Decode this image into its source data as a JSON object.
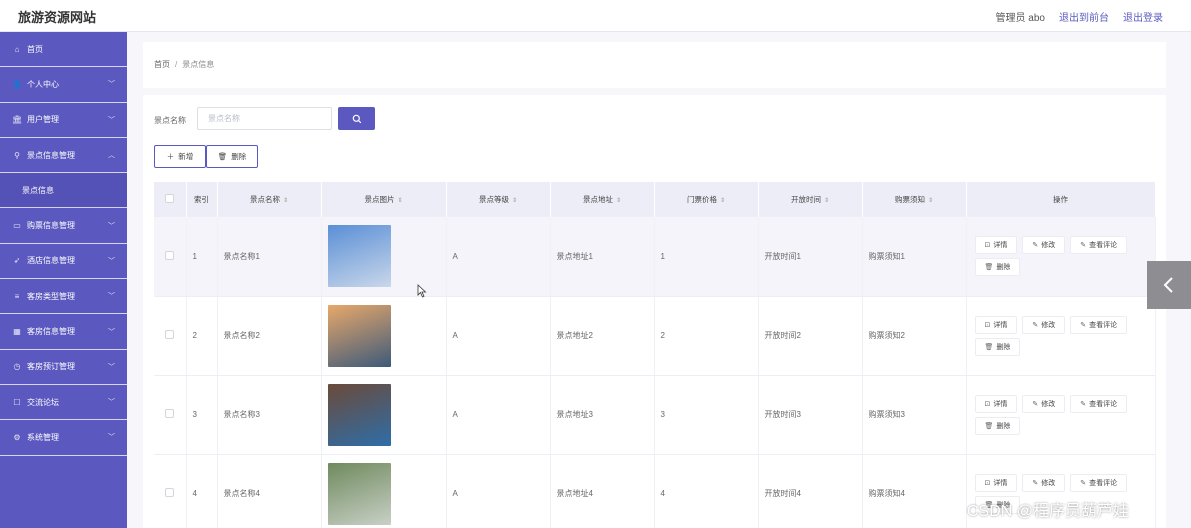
{
  "header": {
    "brand": "旅游资源网站",
    "admin_label": "管理员 abo",
    "back_front": "退出到前台",
    "logout": "退出登录"
  },
  "sidebar": {
    "items": [
      {
        "label": "首页",
        "icon": "home-icon",
        "chevron": false
      },
      {
        "label": "个人中心",
        "icon": "user-icon",
        "chevron": true
      },
      {
        "label": "用户管理",
        "icon": "bank-icon",
        "chevron": true
      },
      {
        "label": "景点信息管理",
        "icon": "location-icon",
        "chevron": true,
        "expanded": true
      },
      {
        "label": "景点信息",
        "icon": "",
        "chevron": false,
        "sub": true
      },
      {
        "label": "购票信息管理",
        "icon": "ticket-icon",
        "chevron": true
      },
      {
        "label": "酒店信息管理",
        "icon": "send-icon",
        "chevron": true
      },
      {
        "label": "客房类型管理",
        "icon": "list-icon",
        "chevron": true
      },
      {
        "label": "客房信息管理",
        "icon": "room-icon",
        "chevron": true
      },
      {
        "label": "客房预订管理",
        "icon": "clock-icon",
        "chevron": true
      },
      {
        "label": "交流论坛",
        "icon": "chat-icon",
        "chevron": true
      },
      {
        "label": "系统管理",
        "icon": "settings-icon",
        "chevron": true
      }
    ]
  },
  "breadcrumb": {
    "home": "首页",
    "separator": "/",
    "current": "景点信息"
  },
  "search": {
    "label": "景点名称",
    "placeholder": "景点名称",
    "value": ""
  },
  "actions": {
    "add": "新增",
    "delete": "删除"
  },
  "table": {
    "columns": [
      "索引",
      "景点名称",
      "景点图片",
      "景点等级",
      "景点地址",
      "门票价格",
      "开放时间",
      "购票须知",
      "操作"
    ],
    "sortable": [
      false,
      true,
      true,
      true,
      true,
      true,
      true,
      true,
      false
    ],
    "rows": [
      {
        "index": "1",
        "name": "景点名称1",
        "image_colors": [
          "#5a8fd6",
          "#c9d7ea"
        ],
        "level": "A",
        "address": "景点地址1",
        "price": "1",
        "open_time": "开放时间1",
        "notice": "购票须知1"
      },
      {
        "index": "2",
        "name": "景点名称2",
        "image_colors": [
          "#e8a86a",
          "#3d5a7a"
        ],
        "level": "A",
        "address": "景点地址2",
        "price": "2",
        "open_time": "开放时间2",
        "notice": "购票须知2"
      },
      {
        "index": "3",
        "name": "景点名称3",
        "image_colors": [
          "#6b4a3a",
          "#2e6ea8"
        ],
        "level": "A",
        "address": "景点地址3",
        "price": "3",
        "open_time": "开放时间3",
        "notice": "购票须知3"
      },
      {
        "index": "4",
        "name": "景点名称4",
        "image_colors": [
          "#6f8a5e",
          "#c8d0c6"
        ],
        "level": "A",
        "address": "景点地址4",
        "price": "4",
        "open_time": "开放时间4",
        "notice": "购票须知4"
      }
    ],
    "row_actions": {
      "detail": "详情",
      "edit": "修改",
      "comments": "查看评论",
      "delete": "删除"
    }
  },
  "watermark": "CSDN @程序员葫芦娃",
  "colors": {
    "accent": "#5b59bf",
    "header_bg": "#ecedf7"
  }
}
